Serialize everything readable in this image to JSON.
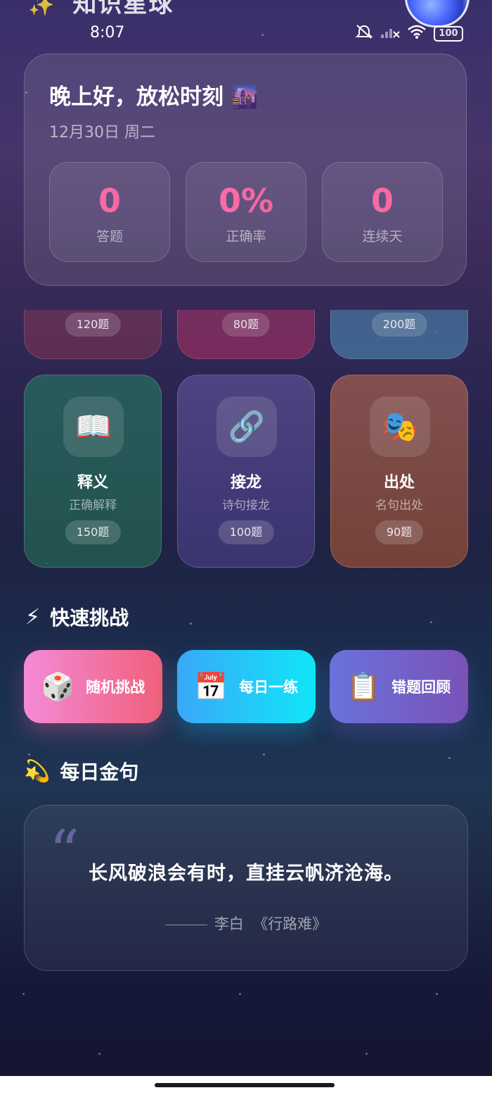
{
  "app": {
    "title": "知识星球",
    "title_icon": "sparkles-icon",
    "avatar_icon": "planet-avatar"
  },
  "status_bar": {
    "time": "8:07",
    "battery": "100"
  },
  "greeting": {
    "title": "晚上好，放松时刻 🌆",
    "date": "12月30日 周二"
  },
  "stats": [
    {
      "value": "0",
      "label": "答题"
    },
    {
      "value": "0%",
      "label": "正确率"
    },
    {
      "value": "0",
      "label": "连续天"
    }
  ],
  "partial_categories": [
    {
      "count": "120题"
    },
    {
      "count": "80题"
    },
    {
      "count": "200题"
    }
  ],
  "categories": [
    {
      "icon": "📖",
      "name": "释义",
      "desc": "正确解释",
      "count": "150题"
    },
    {
      "icon": "🔗",
      "name": "接龙",
      "desc": "诗句接龙",
      "count": "100题"
    },
    {
      "icon": "🎭",
      "name": "出处",
      "desc": "名句出处",
      "count": "90题"
    }
  ],
  "quick": {
    "icon": "⚡",
    "title": "快速挑战",
    "buttons": [
      {
        "icon": "🎲",
        "label": "随机挑战"
      },
      {
        "icon": "📅",
        "label": "每日一练"
      },
      {
        "icon": "📋",
        "label": "错题回顾"
      }
    ]
  },
  "daily_quote": {
    "icon": "💫",
    "title": "每日金句",
    "mark": "“",
    "text": "长风破浪会有时，直挂云帆济沧海。",
    "author": "李白",
    "work": "《行路难》"
  },
  "colors": {
    "accent_pink": "#f06aa8",
    "card_green": "#2e6b60",
    "card_purple": "#4e4580",
    "card_orange": "#8a5440",
    "btn_pink": "#f06aa0",
    "btn_cyan": "#19c2f0",
    "btn_violet": "#7a66d8"
  }
}
